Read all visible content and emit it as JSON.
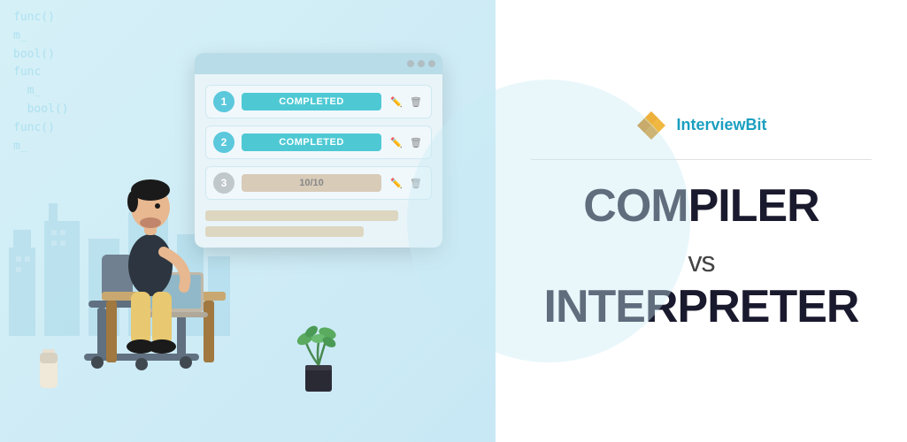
{
  "left_panel": {
    "bg_code_lines": [
      "func()",
      "m_",
      "bool()",
      "func",
      "m_",
      "bool()"
    ],
    "window": {
      "tasks": [
        {
          "number": "1",
          "status": "COMPLETED",
          "type": "completed"
        },
        {
          "number": "2",
          "status": "COMPLETED",
          "type": "completed"
        },
        {
          "number": "3",
          "status": "10/10",
          "type": "progress"
        }
      ]
    }
  },
  "right_panel": {
    "brand": {
      "name_part1": "Interview",
      "name_part2": "Bit"
    },
    "title_line1": "COMPILER",
    "title_vs": "vs",
    "title_line2": "INTERPRETER"
  }
}
